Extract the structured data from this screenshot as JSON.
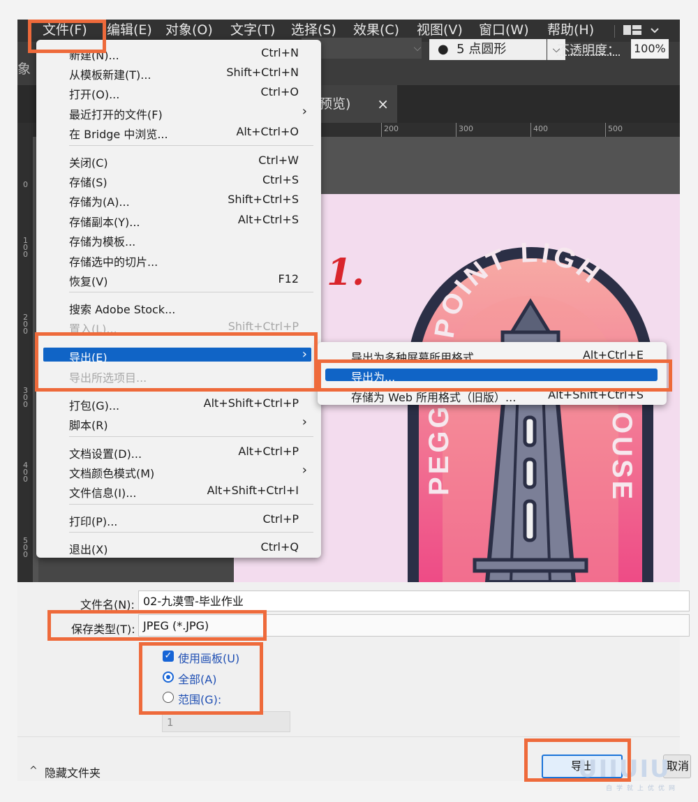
{
  "menubar": {
    "items": [
      "文件(F)",
      "编辑(E)",
      "对象(O)",
      "文字(T)",
      "选择(S)",
      "效果(C)",
      "视图(V)",
      "窗口(W)",
      "帮助(H)"
    ]
  },
  "control_bar": {
    "left_fragment": "象",
    "brush": "5 点圆形",
    "opacity_label": "不透明度：",
    "opacity_value": "100%"
  },
  "document_tab": {
    "label": "预览)",
    "close": "×"
  },
  "ruler": {
    "h_ticks": [
      "200",
      "300",
      "400",
      "500"
    ],
    "v_ticks": [
      "0",
      "100",
      "200",
      "300",
      "400",
      "500"
    ]
  },
  "artwork": {
    "step_number": "1.",
    "badge_top_text": "POINT LIGH",
    "badge_left_text": "PEGG",
    "badge_right_text": "OUSE",
    "colors": {
      "pink_bg": "#f3dcee",
      "badge_dark": "#2b2f46",
      "badge_gradient_top": "#f6a3a0",
      "badge_gradient_bottom": "#ef4b85",
      "tower": "#7b7f97"
    }
  },
  "file_menu": {
    "items": [
      {
        "label": "新建(N)...",
        "shortcut": "Ctrl+N"
      },
      {
        "label": "从模板新建(T)...",
        "shortcut": "Shift+Ctrl+N"
      },
      {
        "label": "打开(O)...",
        "shortcut": "Ctrl+O"
      },
      {
        "label": "最近打开的文件(F)",
        "shortcut": "",
        "submenu": true
      },
      {
        "label": "在 Bridge 中浏览...",
        "shortcut": "Alt+Ctrl+O"
      },
      {
        "label": "关闭(C)",
        "shortcut": "Ctrl+W"
      },
      {
        "label": "存储(S)",
        "shortcut": "Ctrl+S"
      },
      {
        "label": "存储为(A)...",
        "shortcut": "Shift+Ctrl+S"
      },
      {
        "label": "存储副本(Y)...",
        "shortcut": "Alt+Ctrl+S"
      },
      {
        "label": "存储为模板...",
        "shortcut": ""
      },
      {
        "label": "存储选中的切片...",
        "shortcut": ""
      },
      {
        "label": "恢复(V)",
        "shortcut": "F12"
      },
      {
        "label": "搜索 Adobe Stock...",
        "shortcut": ""
      },
      {
        "label": "置入(L)...",
        "shortcut": "Shift+Ctrl+P",
        "disabled": true
      },
      {
        "label": "导出(E)",
        "shortcut": "",
        "submenu": true,
        "highlighted": true
      },
      {
        "label": "导出所选项目...",
        "shortcut": "",
        "disabled": true
      },
      {
        "label": "打包(G)...",
        "shortcut": "Alt+Shift+Ctrl+P"
      },
      {
        "label": "脚本(R)",
        "shortcut": "",
        "submenu": true
      },
      {
        "label": "文档设置(D)...",
        "shortcut": "Alt+Ctrl+P"
      },
      {
        "label": "文档颜色模式(M)",
        "shortcut": "",
        "submenu": true
      },
      {
        "label": "文件信息(I)...",
        "shortcut": "Alt+Shift+Ctrl+I"
      },
      {
        "label": "打印(P)...",
        "shortcut": "Ctrl+P"
      },
      {
        "label": "退出(X)",
        "shortcut": "Ctrl+Q"
      }
    ],
    "submenu_arrow": "›"
  },
  "export_submenu": {
    "items": [
      {
        "label": "导出为多种屏幕所用格式...",
        "shortcut": "Alt+Ctrl+E"
      },
      {
        "label": "导出为...",
        "shortcut": "",
        "highlighted": true
      },
      {
        "label": "存储为 Web 所用格式（旧版）...",
        "shortcut": "Alt+Shift+Ctrl+S"
      }
    ]
  },
  "save_dialog": {
    "filename_label": "文件名(N):",
    "filename_value": "02-九漠雪-毕业作业",
    "filetype_label": "保存类型(T):",
    "filetype_value": "JPEG (*.JPG)",
    "use_artboards": "使用画板(U)",
    "all": "全部(A)",
    "range": "范围(G):",
    "range_value": "1",
    "hide_folders": "隐藏文件夹",
    "hide_folders_icon": "^",
    "export_button": "导出",
    "cancel_button": "取消"
  },
  "watermark": {
    "text": "UIIUIU",
    "sub": "自学就上优优网"
  },
  "annotation_color": "#ee6a3b"
}
